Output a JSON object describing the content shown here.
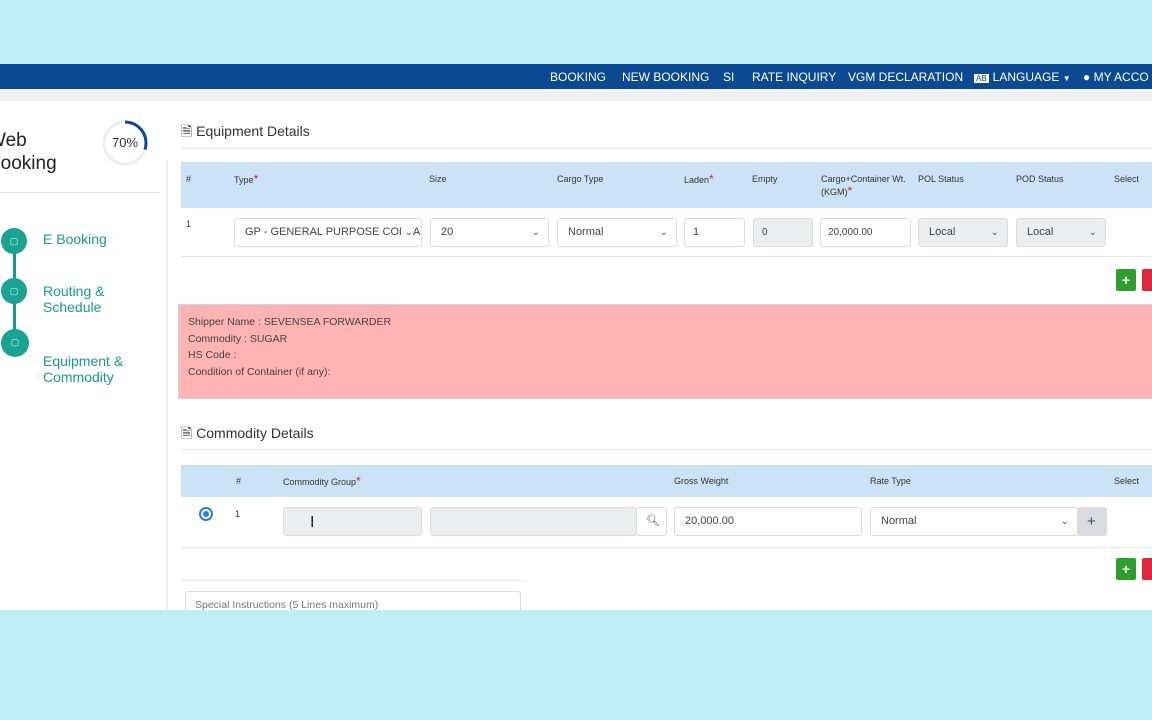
{
  "nav": {
    "items": [
      "BOOKING",
      "NEW BOOKING",
      "SI",
      "RATE INQUIRY",
      "VGM DECLARATION"
    ],
    "language": "LANGUAGE",
    "account": "MY ACCO"
  },
  "sidebar": {
    "title_line1": "Web",
    "title_line2": "Booking",
    "progress_label": "70%",
    "progress": 70,
    "steps": [
      "E Booking",
      "Routing & Schedule",
      "Equipment & Commodity"
    ]
  },
  "equipment": {
    "title": "Equipment Details",
    "headers": {
      "num": "#",
      "type": "Type",
      "size": "Size",
      "cargo_type": "Cargo Type",
      "laden": "Laden",
      "empty": "Empty",
      "weight_line1": "Cargo+Container Wt.",
      "weight_line2": "(KGM)",
      "pol": "POL Status",
      "pod": "POD Status",
      "select": "Select"
    },
    "row": {
      "num": "1",
      "type": "GP - GENERAL PURPOSE CONTAINER",
      "size": "20",
      "cargo_type": "Normal",
      "laden": "1",
      "empty": "0",
      "weight": "20,000.00",
      "pol": "Local",
      "pod": "Local"
    }
  },
  "notice": {
    "lines": [
      "Shipper Name :  SEVENSEA FORWARDER",
      "Commodity : SUGAR",
      "HS Code :",
      "Condition of Container (if any):"
    ]
  },
  "commodity": {
    "title": "Commodity Details",
    "headers": {
      "num": "#",
      "group": "Commodity Group",
      "gross": "Gross Weight",
      "rate": "Rate Type",
      "select": "Select"
    },
    "row": {
      "num": "1",
      "group": "",
      "desc": "",
      "gross": "20,000.00",
      "rate": "Normal"
    }
  },
  "special_placeholder": "Special Instructions (5 Lines maximum)",
  "colors": {
    "nav": "#0b4a92",
    "accent": "#1a9a8a",
    "table_header": "#cce3f7",
    "notice": "#ffb3b3",
    "add": "#2e9e2e",
    "delete": "#e0263d"
  }
}
